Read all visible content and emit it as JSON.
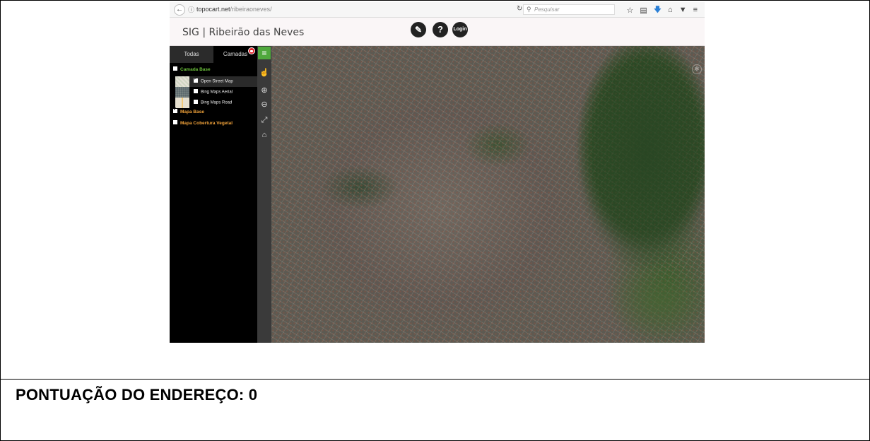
{
  "browser": {
    "url_host": "topocart.net",
    "url_path": "/ribeiraoneves/",
    "search_placeholder": "Pesquisar",
    "icons": [
      "back-arrow-icon",
      "info-icon",
      "reload-icon",
      "search-icon",
      "bookmark-star-icon",
      "reading-list-icon",
      "download-icon",
      "home-icon",
      "pocket-icon",
      "menu-icon"
    ]
  },
  "app": {
    "title": "SIG | Ribeirão das Neves",
    "header_buttons": {
      "draw_icon": "pencil-off-icon",
      "help_label": "?",
      "login_label": "Login"
    }
  },
  "panel": {
    "tabs": [
      {
        "label": "Todas"
      },
      {
        "label": "Camadas"
      }
    ],
    "groups": [
      {
        "label": "Camada Base",
        "checked": false,
        "color": "#6bbf3b"
      },
      {
        "label": "Mapa Base",
        "checked": true,
        "color": "#f2a33a"
      },
      {
        "label": "Mapa Cobertura Vegetal",
        "checked": false,
        "color": "#f2a33a"
      }
    ],
    "base_layers": [
      {
        "label": "Open Street Map",
        "checked": true
      },
      {
        "label": "Bing Maps Aerial",
        "checked": false
      },
      {
        "label": "Bing Maps Road",
        "checked": false
      }
    ]
  },
  "tools": [
    "menu-icon",
    "pointer-icon",
    "zoom-in-icon",
    "zoom-out-icon",
    "fullscreen-icon",
    "home-icon"
  ],
  "document": {
    "score_label": "PONTUAÇÃO DO ENDEREÇO: 0"
  }
}
